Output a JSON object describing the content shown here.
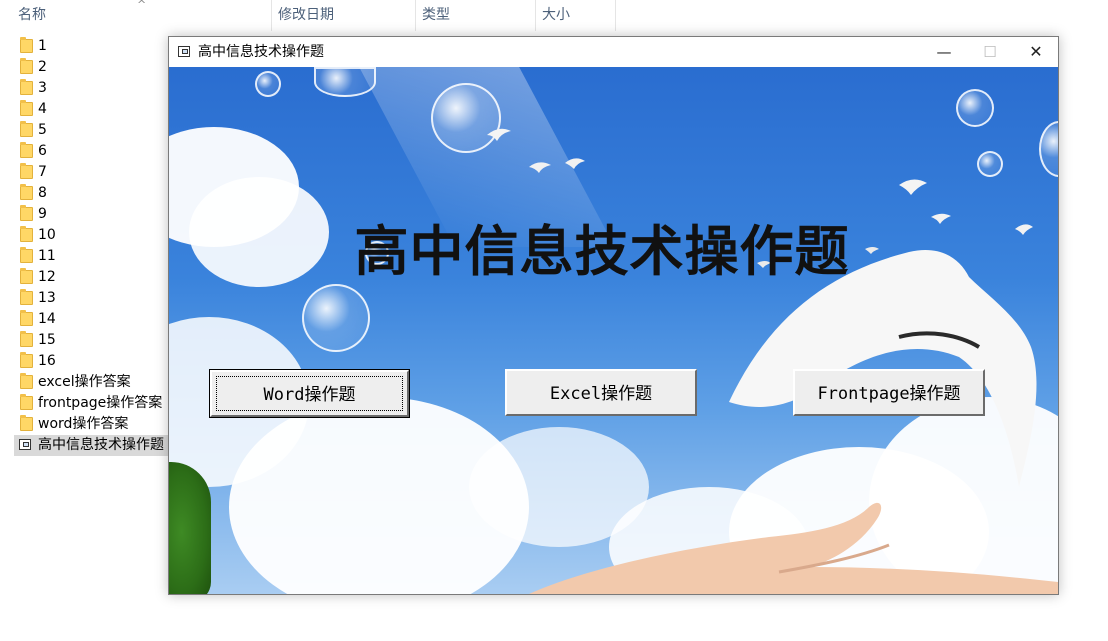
{
  "explorer": {
    "columns": [
      {
        "label": "名称"
      },
      {
        "label": "修改日期"
      },
      {
        "label": "类型"
      },
      {
        "label": "大小"
      }
    ],
    "sort_indicator": "^",
    "files": [
      {
        "name": "1",
        "icon": "folder-icon"
      },
      {
        "name": "2",
        "icon": "folder-icon"
      },
      {
        "name": "3",
        "icon": "folder-icon"
      },
      {
        "name": "4",
        "icon": "folder-icon"
      },
      {
        "name": "5",
        "icon": "folder-icon"
      },
      {
        "name": "6",
        "icon": "folder-icon"
      },
      {
        "name": "7",
        "icon": "folder-icon"
      },
      {
        "name": "8",
        "icon": "folder-icon"
      },
      {
        "name": "9",
        "icon": "folder-icon"
      },
      {
        "name": "10",
        "icon": "folder-icon"
      },
      {
        "name": "11",
        "icon": "folder-icon"
      },
      {
        "name": "12",
        "icon": "folder-icon"
      },
      {
        "name": "13",
        "icon": "folder-icon"
      },
      {
        "name": "14",
        "icon": "folder-icon"
      },
      {
        "name": "15",
        "icon": "folder-icon"
      },
      {
        "name": "16",
        "icon": "folder-icon"
      },
      {
        "name": "excel操作答案",
        "icon": "folder-icon"
      },
      {
        "name": "frontpage操作答案",
        "icon": "folder-icon"
      },
      {
        "name": "word操作答案",
        "icon": "folder-icon"
      },
      {
        "name": "高中信息技术操作题",
        "icon": "application-icon",
        "selected": true
      }
    ]
  },
  "window": {
    "title": "高中信息技术操作题",
    "minimize": "—",
    "maximize": "☐",
    "close": "✕"
  },
  "app": {
    "heading": "高中信息技术操作题",
    "buttons": {
      "word": "Word操作题",
      "excel": "Excel操作题",
      "frontpage": "Frontpage操作题"
    }
  },
  "colors": {
    "sky": "#3a83dc",
    "button_face": "#eeeeee",
    "folder": "#ffd766"
  }
}
